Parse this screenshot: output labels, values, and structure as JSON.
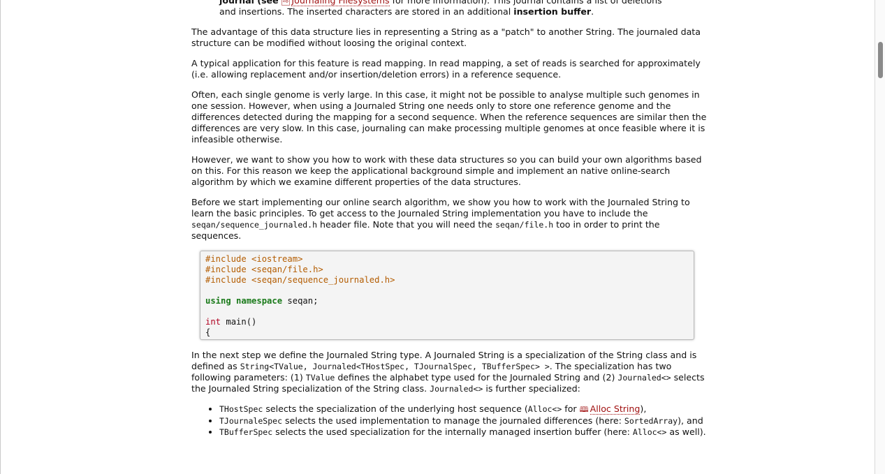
{
  "first_block": {
    "line1_prefix": "journal (see ",
    "link_label": "Journaling Filesystems",
    "line1_suffix": " for more information). This journal contains a list of deletions",
    "line2_prefix": "and insertions. The inserted characters are stored in an additional ",
    "line2_bold": "insertion buffer",
    "line2_suffix": "."
  },
  "paragraphs": {
    "advantage": "The advantage of this data structure lies in representing a String as a \"patch\" to another String. The journaled data structure can be modified without loosing the original context.",
    "application": "A typical application for this feature is read mapping. In read mapping, a set of reads is searched for approximately (i.e. allowing replacement and/or insertion/deletion errors) in a reference sequence.",
    "genomes": "Often, each single genome is verly large. In this case, it might not be possible to analyse multiple such genomes in one session. However, when using a Journaled String one needs only to store one reference genome and the differences detected during the mapping for a second sequence. When the reference sequences are similar then the differences are very slow. In this case, journaling can make processing multiple genomes at once feasible where it is infeasible otherwise.",
    "however": "However, we want to show you how to work with these data structures so you can build your own algorithms based on this. For this reason we keep the applicational background simple and implement an native online-search algorithm by which we examine different properties of the data structures."
  },
  "before": {
    "t1": "Before we start implementing our online search algorithm, we show you how to work with the Journaled String to learn the basic principles. To get access to the Journaled String implementation you have to include the ",
    "c1": "seqan/sequence_journaled.h",
    "t2": " header file. Note that you will need the ",
    "c2": "seqan/file.h",
    "t3": " too in order to print the sequences."
  },
  "code": {
    "include1": "#include <iostream>",
    "include2": "#include <seqan/file.h>",
    "include3": "#include <seqan/sequence_journaled.h>",
    "using_kw": "using namespace",
    "using_rest": " seqan;",
    "int_kw": "int",
    "main_rest": " main()",
    "brace": "{"
  },
  "next_step": {
    "t1": "In the next step we define the Journaled String type. A Journaled String is a specialization of the String class and is defined as ",
    "c1": "String<TValue, Journaled<THostSpec, TJournalSpec, TBufferSpec> >",
    "t2": ". The specialization has two following parameters: (1) ",
    "c2": "TValue",
    "t3": " defines the alphabet type used for the Journaled String and (2) ",
    "c3": "Journaled<>",
    "t4": " selects the Journaled String specialization of the String class. ",
    "c4": "Journaled<>",
    "t5": " is further specialized:"
  },
  "bullets": [
    {
      "code": "THostSpec",
      "text": " selects the specialization of the underlying host sequence (",
      "code2": "Alloc<>",
      "text2": " for ",
      "link": "Alloc String",
      "text3": "),",
      "text4": ""
    },
    {
      "code": "TJournaleSpec",
      "text": " selects the used implementation to manage the journaled differences (here: ",
      "code2": "SortedArray",
      "text2": "), and",
      "link": "",
      "text3": "",
      "text4": ""
    },
    {
      "code": "TBufferSpec",
      "text": " selects the used specialization for the internally managed insertion buffer (here: ",
      "code2": "Alloc<>",
      "text2": " as well).",
      "link": "",
      "text3": "",
      "text4": ""
    }
  ]
}
